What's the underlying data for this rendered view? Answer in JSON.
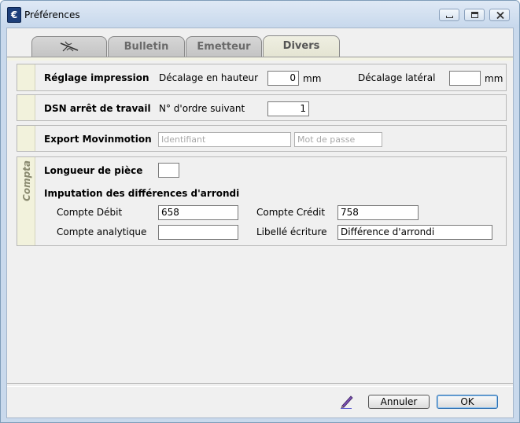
{
  "window": {
    "title": "Préférences",
    "icon": "euro-app-icon"
  },
  "tabs": [
    {
      "label": "",
      "icon": "dragonfly-icon"
    },
    {
      "label": "Bulletin"
    },
    {
      "label": "Emetteur"
    },
    {
      "label": "Divers",
      "active": true
    }
  ],
  "reglage": {
    "title": "Réglage impression",
    "hauteur_label": "Décalage en hauteur",
    "hauteur_value": "0",
    "hauteur_unit": "mm",
    "lateral_label": "Décalage latéral",
    "lateral_value": "",
    "lateral_unit": "mm"
  },
  "dsn": {
    "title": "DSN arrêt de travail",
    "ordre_label": "N° d'ordre suivant",
    "ordre_value": "1"
  },
  "export": {
    "title": "Export Movinmotion",
    "identifiant_placeholder": "Identifiant",
    "password_placeholder": "Mot de passe"
  },
  "compta": {
    "side_label": "Compta",
    "longueur_label": "Longueur de pièce",
    "longueur_value": "",
    "imputation_title": "Imputation des différences d'arrondi",
    "compte_debit_label": "Compte Débit",
    "compte_debit_value": "658",
    "compte_credit_label": "Compte Crédit",
    "compte_credit_value": "758",
    "analytique_label": "Compte analytique",
    "analytique_value": "",
    "libelle_label": "Libellé écriture",
    "libelle_value": "Différence d'arrondi"
  },
  "footer": {
    "edit_icon": "pencil-icon",
    "cancel_label": "Annuler",
    "ok_label": "OK"
  }
}
